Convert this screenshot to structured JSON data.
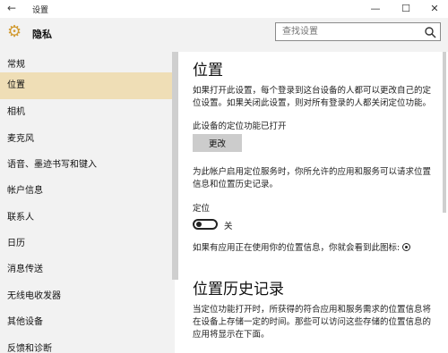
{
  "window": {
    "title": "设置",
    "back_glyph": "←",
    "minimize_glyph": "—",
    "maximize_glyph": "☐",
    "close_glyph": "✕"
  },
  "header": {
    "gear_glyph": "⚙",
    "category": "隐私",
    "search_placeholder": "查找设置"
  },
  "sidebar": {
    "items": [
      {
        "label": "常规"
      },
      {
        "label": "位置",
        "active": true
      },
      {
        "label": "相机"
      },
      {
        "label": "麦克风"
      },
      {
        "label": "语音、墨迹书写和键入"
      },
      {
        "label": "帐户信息"
      },
      {
        "label": "联系人"
      },
      {
        "label": "日历"
      },
      {
        "label": "消息传送"
      },
      {
        "label": "无线电收发器"
      },
      {
        "label": "其他设备"
      },
      {
        "label": "反馈和诊断"
      }
    ]
  },
  "main": {
    "location_title": "位置",
    "location_desc": "如果打开此设置，每个登录到这台设备的人都可以更改自己的定位设置。如果关闭此设置，则对所有登录的人都关闭定位功能。",
    "device_status": "此设备的定位功能已打开",
    "change_button": "更改",
    "service_desc": "为此帐户启用定位服务时，你所允许的应用和服务可以请求位置信息和位置历史记录。",
    "location_label": "定位",
    "toggle_state": "关",
    "icon_notice": "如果有应用正在使用你的位置信息，你就会看到此图标:",
    "history_title": "位置历史记录",
    "history_desc": "当定位功能打开时，所获得的符合应用和服务需求的位置信息将在设备上存储一定的时间。那些可以访问这些存储的位置信息的应用将显示在下面。"
  },
  "colors": {
    "sidebar_bg": "#f2f2f2",
    "active_item": "#efdeb6",
    "accent_gear": "#d29b32",
    "button_bg": "#cccccc"
  }
}
